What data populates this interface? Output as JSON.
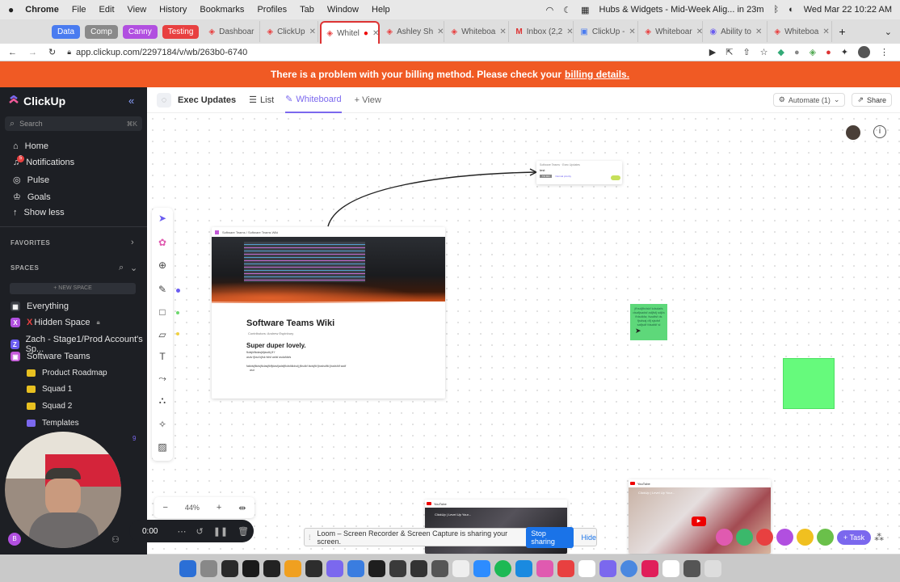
{
  "menubar": {
    "app": "Chrome",
    "items": [
      "File",
      "Edit",
      "View",
      "History",
      "Bookmarks",
      "Profiles",
      "Tab",
      "Window",
      "Help"
    ],
    "event": "Hubs & Widgets - Mid-Week Alig... in 23m",
    "datetime": "Wed Mar 22  10:22 AM"
  },
  "tab_groups": [
    {
      "label": "Data",
      "color": "#4a7cf0"
    },
    {
      "label": "Comp",
      "color": "#8a8a8a"
    },
    {
      "label": "Canny",
      "color": "#b14fe0"
    },
    {
      "label": "Testing",
      "color": "#e84040"
    }
  ],
  "tabs": [
    "Dashboar",
    "ClickUp",
    "Whitel",
    "Ashley Sh",
    "Whiteboa",
    "Inbox (2,2",
    "ClickUp -",
    "Whiteboar",
    "Ability to",
    "Whiteboa"
  ],
  "address": "app.clickup.com/2297184/v/wb/263b0-6740",
  "banner": {
    "text": "There is a problem with your billing method. Please check your",
    "link": "billing details."
  },
  "sidebar": {
    "brand": "ClickUp",
    "search_placeholder": "Search",
    "search_shortcut": "⌘K",
    "nav": [
      "Home",
      "Notifications",
      "Pulse",
      "Goals",
      "Show less"
    ],
    "notif_badge": "5",
    "favorites": "FAVORITES",
    "spaces": "SPACES",
    "new_space": "+ NEW SPACE",
    "space_items": [
      "Everything",
      "Hidden Space",
      "Zach - Stage1/Prod Account's Sp...",
      "Software Teams"
    ],
    "folders": [
      "Product Roadmap",
      "Squad 1",
      "Squad 2",
      "Templates"
    ],
    "count": "9",
    "avatar": "B"
  },
  "header": {
    "title": "Exec Updates",
    "tab_list": "List",
    "tab_whiteboard": "Whiteboard",
    "add_view": "+ View",
    "automate": "Automate (1)",
    "share": "Share"
  },
  "canvas": {
    "wiki_breadcrumb": "Software Teams  /  Software Teams Wiki",
    "wiki_title": "Software Teams Wiki",
    "wiki_contributors": "Contributors: Andrew Espinbury",
    "wiki_subtitle": "Super duper lovely.",
    "wiki_line1": "fkdsjkflkdasjkfjasdkj ff f",
    "wiki_line2": "asdv fjksd kjfsk fsfsf asfsf asdafdsfs",
    "wiki_line3": "fakldsjflkdsjfkdasjfkffjdasfjadsfjfkdsfdkdsdj jfksdkf fadsjfkf jbadsdfkl jbadsfdf sadf",
    "wiki_line4": "asd",
    "small_card_title": "Software Teams · Exec Updates",
    "small_card_text": "test",
    "small_card_tag": "TO DO",
    "small_card_meta": "Normal priority",
    "sticky_text": "jfhsdjfhdskf kdsdafs dsafjsadsf adjfsfj sdjfa fhlsdkfa; fsadfsf ds fjsdsaj dfj sjsdsf safjsdf fdsafdf sl",
    "yt_label": "YouTube",
    "yt_title": "ClickUp | Level Up Your...",
    "zoom": "44%"
  },
  "loom": {
    "timer": "0:00",
    "share_text": "Loom – Screen Recorder & Screen Capture is sharing your screen.",
    "stop": "Stop sharing",
    "hide": "Hide"
  },
  "task_button": "+ Task"
}
